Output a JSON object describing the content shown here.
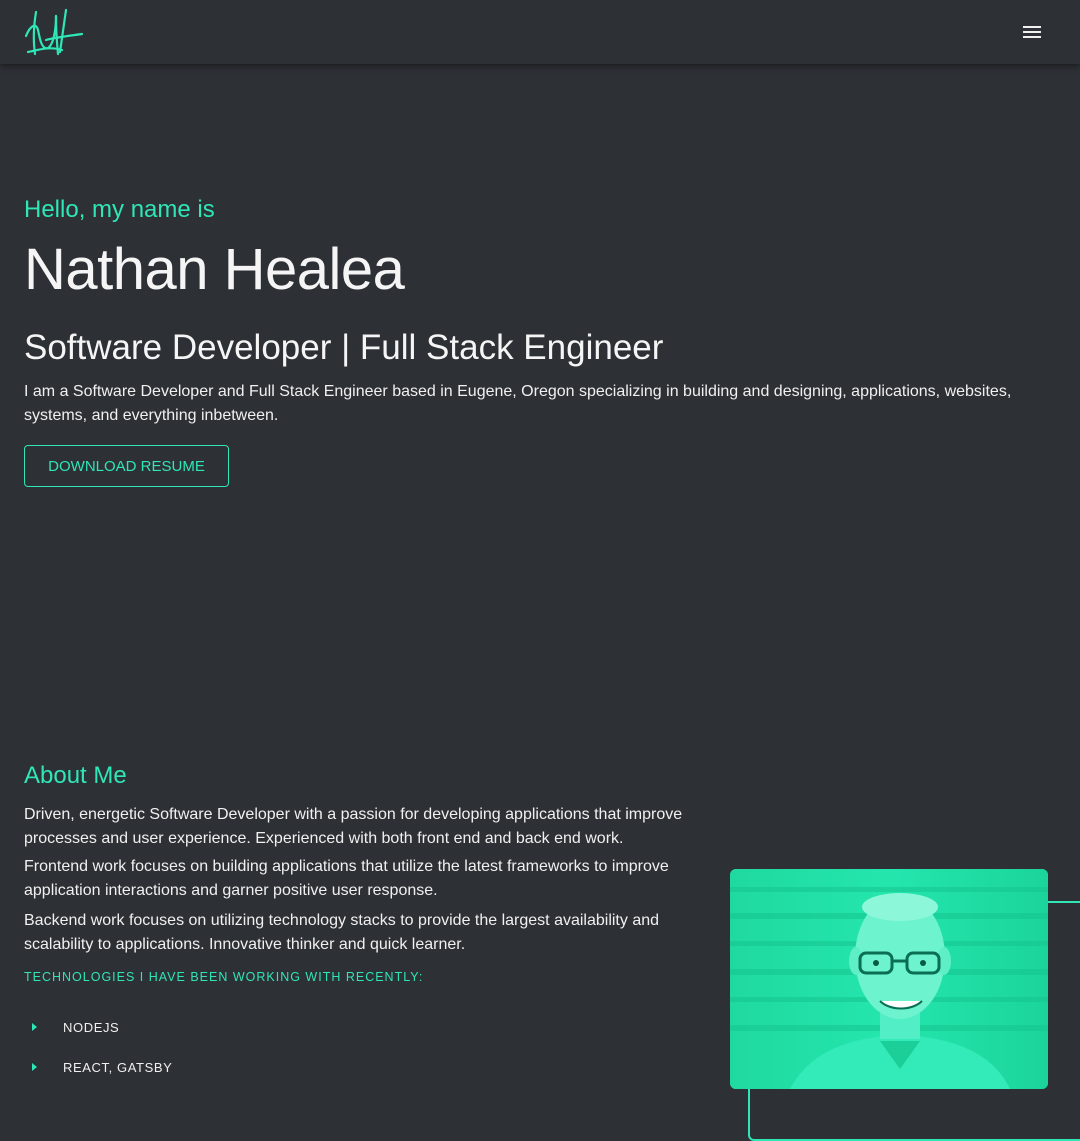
{
  "header": {
    "logo_icon": "nh-signature-logo",
    "menu_icon": "hamburger-menu-icon"
  },
  "hero": {
    "greeting": "Hello, my name is",
    "name": "Nathan Healea",
    "role": "Software Developer | Full Stack Engineer",
    "intro": "I am a Software Developer and Full Stack Engineer based in Eugene, Oregon specializing in building and designing, applications, websites, systems, and everything inbetween.",
    "resume_button": "DOWNLOAD RESUME"
  },
  "about": {
    "title": "About Me",
    "paragraphs": [
      "Driven, energetic Software Developer with a passion for developing applications that improve processes and user experience. Experienced with both front end and back end work.",
      "Frontend work focuses on building applications that utilize the latest frameworks to improve application interactions and garner positive user response.",
      "Backend work focuses on utilizing technology stacks to provide the largest availability and scalability to applications. Innovative thinker and quick learner."
    ],
    "tech_heading": "TECHNOLOGIES I HAVE BEEN WORKING WITH RECENTLY:",
    "tech_items": [
      "NODEJS",
      "REACT, GATSBY"
    ]
  },
  "colors": {
    "background": "#2d3035",
    "accent": "#2ee6b6",
    "text": "#f0f0f0"
  }
}
